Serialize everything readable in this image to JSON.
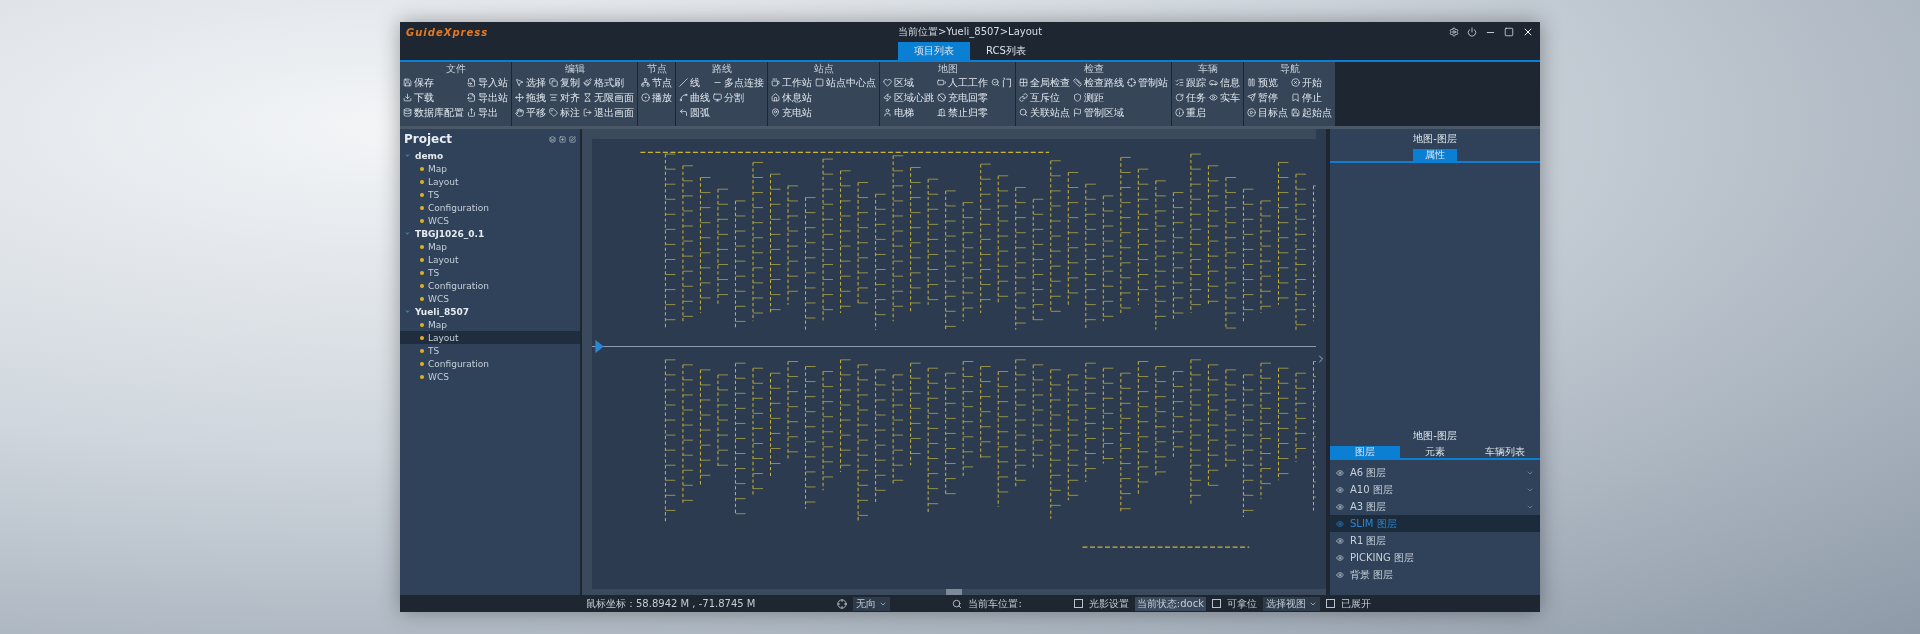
{
  "window": {
    "logo": "GuideXpress",
    "title": "当前位置>Yueli_8507>Layout"
  },
  "top_tabs": [
    {
      "label": "项目列表",
      "selected": true
    },
    {
      "label": "RCS列表",
      "selected": false
    }
  ],
  "ribbon": [
    {
      "title": "文件",
      "items": [
        "保存",
        "下载",
        "数据库配置",
        "导入站",
        "导出站",
        "导出"
      ]
    },
    {
      "title": "编辑",
      "items": [
        "选择",
        "拖拽",
        "平移",
        "复制",
        "对齐",
        "标注",
        "格式刷",
        "无限画面",
        "退出画面"
      ]
    },
    {
      "title": "节点",
      "items": [
        "节点",
        "播放"
      ]
    },
    {
      "title": "路线",
      "items": [
        "线",
        "曲线",
        "圆弧",
        "多点连接",
        "分割"
      ]
    },
    {
      "title": "站点",
      "items": [
        "工作站",
        "休息站",
        "充电站",
        "站点中心点"
      ]
    },
    {
      "title": "地图",
      "items": [
        "区域",
        "区域心跳",
        "电梯",
        "人工工作",
        "充电回零",
        "禁止归零",
        "门"
      ]
    },
    {
      "title": "检查",
      "items": [
        "全局检查",
        "互斥位",
        "关联站点",
        "检查路线",
        "测距",
        "管制区域",
        "管制站"
      ]
    },
    {
      "title": "车辆",
      "items": [
        "跟踪",
        "任务",
        "重启",
        "信息",
        "实车"
      ]
    },
    {
      "title": "导航",
      "items": [
        "预览",
        "暂停",
        "目标点",
        "开始",
        "停止",
        "起始点"
      ]
    }
  ],
  "project": {
    "title": "Project",
    "tree": [
      {
        "label": "demo",
        "expanded": true,
        "children": [
          {
            "label": "Map",
            "selected": false
          },
          {
            "label": "Layout",
            "selected": false
          },
          {
            "label": "TS",
            "selected": false
          },
          {
            "label": "Configuration",
            "selected": false
          },
          {
            "label": "WCS",
            "selected": false
          }
        ]
      },
      {
        "label": "TBGJ1026_0.1",
        "expanded": true,
        "children": [
          {
            "label": "Map",
            "selected": false
          },
          {
            "label": "Layout",
            "selected": false
          },
          {
            "label": "TS",
            "selected": false
          },
          {
            "label": "Configuration",
            "selected": false
          },
          {
            "label": "WCS",
            "selected": false
          }
        ]
      },
      {
        "label": "Yueli_8507",
        "expanded": true,
        "children": [
          {
            "label": "Map",
            "selected": false
          },
          {
            "label": "Layout",
            "selected": true
          },
          {
            "label": "TS",
            "selected": false
          },
          {
            "label": "Configuration",
            "selected": false
          },
          {
            "label": "WCS",
            "selected": false
          }
        ]
      }
    ]
  },
  "properties_panel": {
    "title": "地图-图层",
    "tabs": [
      {
        "label": "属性",
        "selected": true
      }
    ]
  },
  "layers_panel": {
    "title": "地图-图层",
    "tabs": [
      {
        "label": "图层",
        "selected": true
      },
      {
        "label": "元素",
        "selected": false
      },
      {
        "label": "车辆列表",
        "selected": false
      }
    ],
    "layers": [
      {
        "label": "A6 图层",
        "expandable": true,
        "selected": false
      },
      {
        "label": "A10 图层",
        "expandable": true,
        "selected": false
      },
      {
        "label": "A3 图层",
        "expandable": true,
        "selected": false
      },
      {
        "label": "SLIM 图层",
        "expandable": false,
        "selected": true
      },
      {
        "label": "R1 图层",
        "expandable": false,
        "selected": false
      },
      {
        "label": "PICKING 图层",
        "expandable": false,
        "selected": false
      },
      {
        "label": "背景 图层",
        "expandable": false,
        "selected": false
      }
    ]
  },
  "status_bar": {
    "coordinates": "鼠标坐标：58.8942 M , -71.8745 M",
    "direction": "无向",
    "vehicle_position": "当前车位置:",
    "checks": [
      {
        "label": "光影设置",
        "checked": false
      },
      {
        "label": "可拿位",
        "checked": false
      }
    ],
    "state_button": "当前状态:dock",
    "view_select": "选择视图",
    "expanded": {
      "label": "已展开",
      "checked": false
    }
  }
}
